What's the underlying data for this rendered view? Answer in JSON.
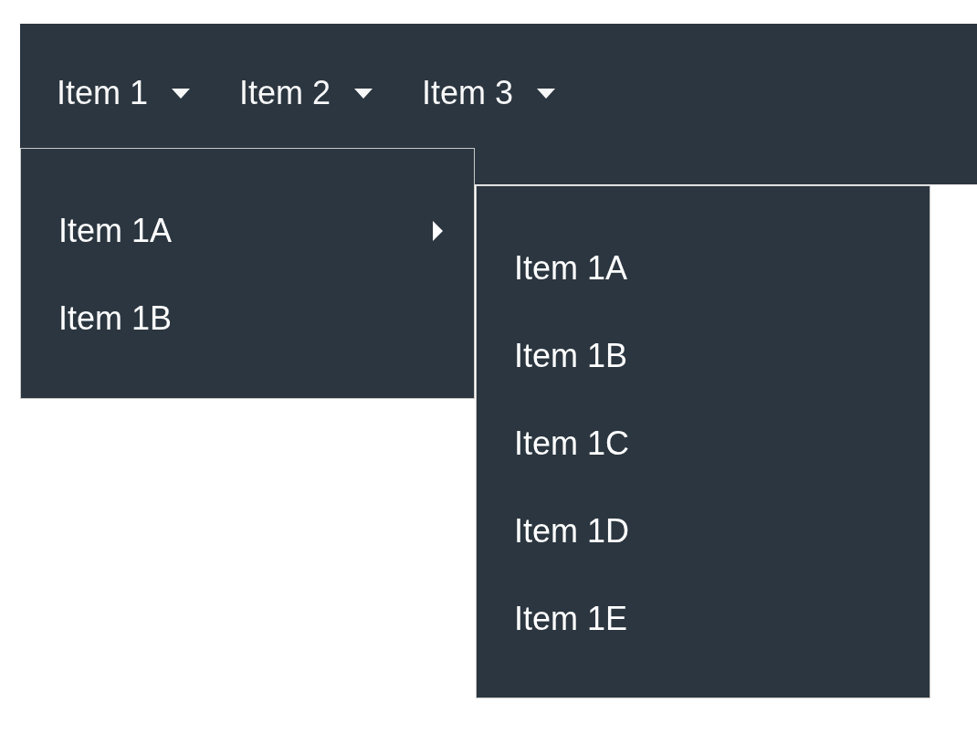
{
  "menubar": [
    {
      "label": "Item 1",
      "children": [
        {
          "label": "Item 1A",
          "children": [
            {
              "label": "Item 1A"
            },
            {
              "label": "Item 1B"
            },
            {
              "label": "Item 1C"
            },
            {
              "label": "Item 1D"
            },
            {
              "label": "Item 1E"
            }
          ]
        },
        {
          "label": "Item 1B"
        }
      ]
    },
    {
      "label": "Item 2"
    },
    {
      "label": "Item 3"
    }
  ]
}
